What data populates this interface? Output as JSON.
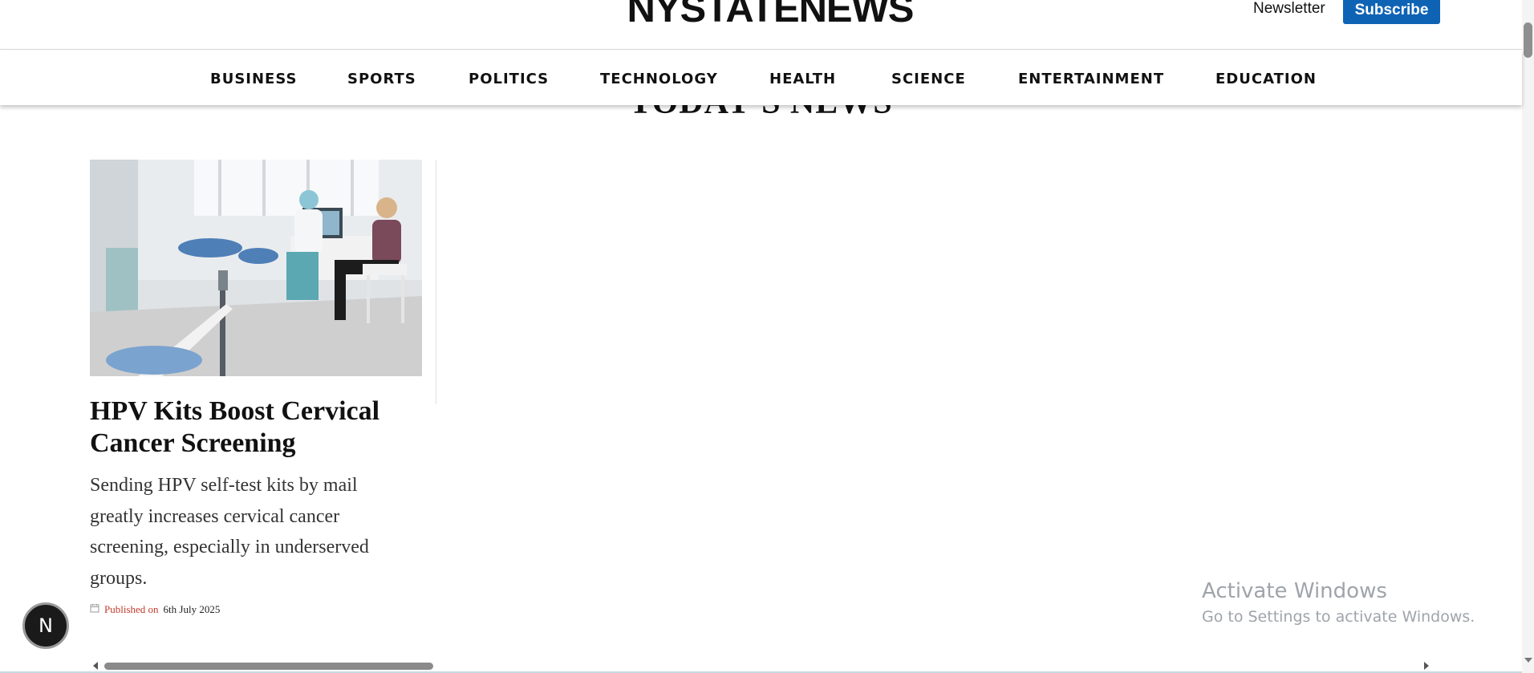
{
  "header": {
    "logo": "NYSTATENEWS",
    "newsletter_label": "Newsletter",
    "subscribe_label": "Subscribe",
    "subscribe_color": "#0e63b5"
  },
  "nav": {
    "categories": [
      "BUSINESS",
      "SPORTS",
      "POLITICS",
      "TECHNOLOGY",
      "HEALTH",
      "SCIENCE",
      "ENTERTAINMENT",
      "EDUCATION"
    ]
  },
  "main": {
    "section_title": "TODAY'S NEWS",
    "articles": [
      {
        "image_icon": "clinic-photo",
        "title": "HPV Kits Boost Cervical Cancer Screening",
        "summary": "Sending HPV self-test kits by mail greatly increases cervical cancer screening, especially in underserved groups.",
        "meta_icon": "calendar-icon",
        "published_label": "Published on",
        "date": "6th July 2025",
        "published_color": "#c0392b"
      }
    ]
  },
  "floating_badge": {
    "label": "N"
  },
  "watermark": {
    "line1": "Activate Windows",
    "line2": "Go to Settings to activate Windows."
  }
}
